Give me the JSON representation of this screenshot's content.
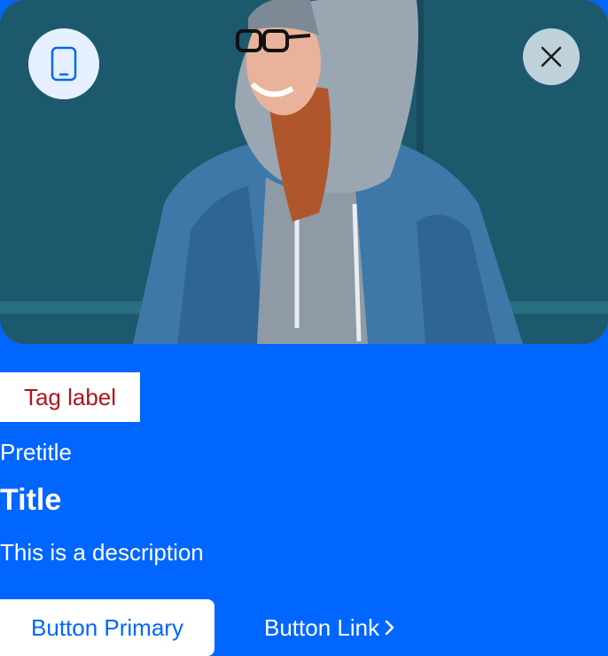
{
  "card": {
    "media": {
      "description_icon": "mobile-phone-icon",
      "close_icon": "close-icon"
    },
    "tag_label": "Tag label",
    "pretitle": "Pretitle",
    "title": "Title",
    "description": "This is a description",
    "primary_button_label": "Button Primary",
    "link_button_label": "Button Link",
    "link_icon": "chevron-right-icon"
  },
  "colors": {
    "background": "#0066ff",
    "tag_text": "#b0141c",
    "badge_bg": "#e6f0ff",
    "white": "#ffffff"
  }
}
